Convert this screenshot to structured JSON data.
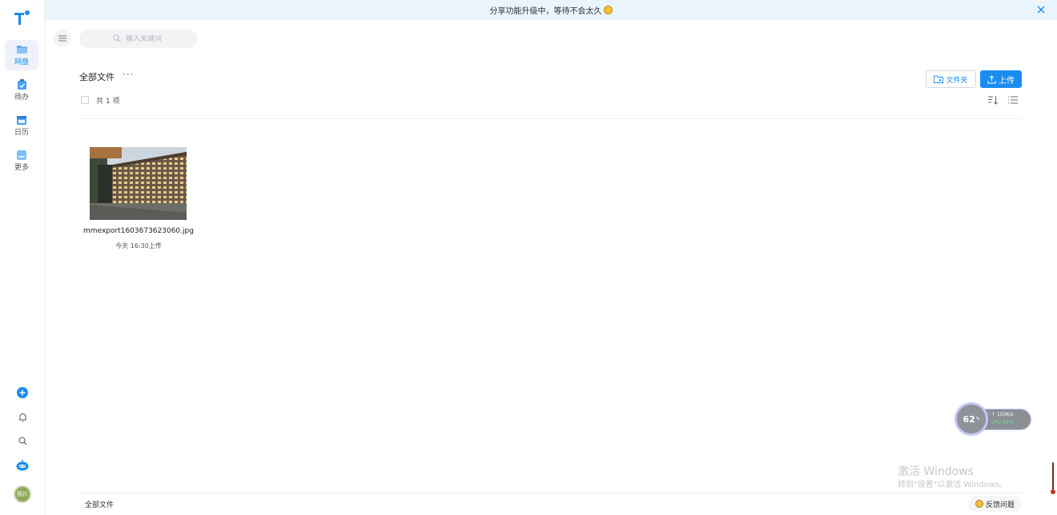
{
  "banner": {
    "text": "分享功能升级中，等待不会太久",
    "emoji_icon": "smile-emoji-icon",
    "close_icon": "close-icon"
  },
  "sidebar": {
    "logo_icon": "app-logo-icon",
    "items": [
      {
        "label": "网盘",
        "icon": "folder-icon",
        "active": true
      },
      {
        "label": "待办",
        "icon": "todo-icon",
        "active": false
      },
      {
        "label": "日历",
        "icon": "calendar-icon",
        "active": false
      },
      {
        "label": "更多",
        "icon": "more-apps-icon",
        "active": false
      }
    ],
    "avatar_text": "照片"
  },
  "search": {
    "placeholder": "输入关键词"
  },
  "header": {
    "title": "全部文件",
    "more": "···",
    "folder_button": "文件夹",
    "upload_button": "上传",
    "count": "共 1 项"
  },
  "files": [
    {
      "name": "mmexport1603673623060.jpg",
      "time": "今天 16:30上传"
    }
  ],
  "footer": {
    "breadcrumb": "全部文件",
    "feedback": "反馈问题"
  },
  "widget": {
    "percent": "62",
    "unit": "%",
    "net": "↑ 150K/s",
    "cpu": "CPU 39°C"
  },
  "watermark": {
    "title": "激活 Windows",
    "subtitle": "转到\"设置\"以激活 Windows。"
  },
  "colors": {
    "accent": "#1a8cf0",
    "banner_bg": "#eaf4fd"
  }
}
